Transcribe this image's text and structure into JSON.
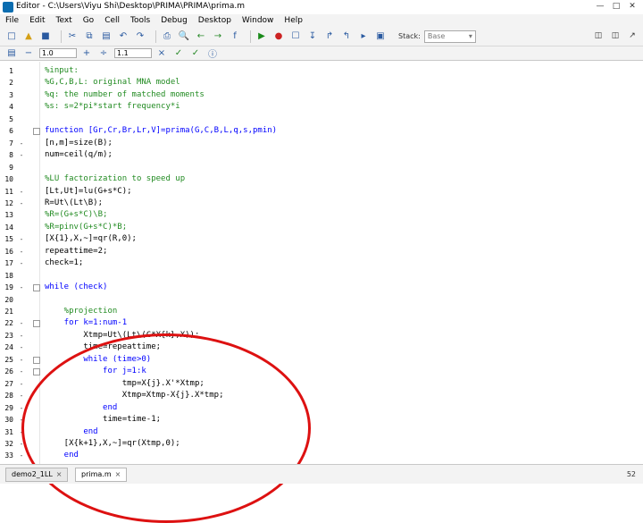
{
  "window": {
    "app": "Editor",
    "path": "C:\\Users\\Viyu Shi\\Desktop\\PRIMA\\PRIMA\\prima.m"
  },
  "menu": [
    "File",
    "Edit",
    "Text",
    "Go",
    "Cell",
    "Tools",
    "Debug",
    "Desktop",
    "Window",
    "Help"
  ],
  "toolbar": {
    "stack_label": "Stack:",
    "stack_value": "Base"
  },
  "cellbar": {
    "value1": "1.0",
    "value2": "1.1"
  },
  "lines": [
    {
      "n": "1",
      "m": "",
      "t": "%input:",
      "c": "comment"
    },
    {
      "n": "2",
      "m": "",
      "t": "%G,C,B,L: original MNA model",
      "c": "comment"
    },
    {
      "n": "3",
      "m": "",
      "t": "%q: the number of matched moments",
      "c": "comment"
    },
    {
      "n": "4",
      "m": "",
      "t": "%s: s=2*pi*start frequency*i",
      "c": "comment"
    },
    {
      "n": "5",
      "m": "",
      "t": "",
      "c": "normal"
    },
    {
      "n": "6",
      "m": "",
      "t": "function [Gr,Cr,Br,Lr,V]=prima(G,C,B,L,q,s,pmin)",
      "c": "kw"
    },
    {
      "n": "7",
      "m": "-",
      "t": "[n,m]=size(B);",
      "c": "normal"
    },
    {
      "n": "8",
      "m": "-",
      "t": "num=ceil(q/m);",
      "c": "normal"
    },
    {
      "n": "9",
      "m": "",
      "t": "",
      "c": "normal"
    },
    {
      "n": "10",
      "m": "",
      "t": "%LU factorization to speed up",
      "c": "comment"
    },
    {
      "n": "11",
      "m": "-",
      "t": "[Lt,Ut]=lu(G+s*C);",
      "c": "normal"
    },
    {
      "n": "12",
      "m": "-",
      "t": "R=Ut\\(Lt\\B);",
      "c": "normal"
    },
    {
      "n": "13",
      "m": "",
      "t": "%R=(G+s*C)\\B;",
      "c": "comment"
    },
    {
      "n": "14",
      "m": "",
      "t": "%R=pinv(G+s*C)*B;",
      "c": "comment"
    },
    {
      "n": "15",
      "m": "-",
      "t": "[X{1},X,~]=qr(R,0);",
      "c": "normal"
    },
    {
      "n": "16",
      "m": "-",
      "t": "repeattime=2;",
      "c": "normal"
    },
    {
      "n": "17",
      "m": "-",
      "t": "check=1;",
      "c": "normal"
    },
    {
      "n": "18",
      "m": "",
      "t": "",
      "c": "normal"
    },
    {
      "n": "19",
      "m": "-",
      "t": "while (check)",
      "c": "kw"
    },
    {
      "n": "20",
      "m": "",
      "t": "",
      "c": "normal"
    },
    {
      "n": "21",
      "m": "",
      "t": "    %projection",
      "c": "comment"
    },
    {
      "n": "22",
      "m": "-",
      "t": "    for k=1:num-1",
      "c": "kw"
    },
    {
      "n": "23",
      "m": "-",
      "t": "        Xtmp=Ut\\(Lt\\(C*X{k},X));",
      "c": "normal"
    },
    {
      "n": "24",
      "m": "-",
      "t": "        time=repeattime;",
      "c": "normal"
    },
    {
      "n": "25",
      "m": "-",
      "t": "        while (time>0)",
      "c": "kw"
    },
    {
      "n": "26",
      "m": "-",
      "t": "            for j=1:k",
      "c": "kw"
    },
    {
      "n": "27",
      "m": "-",
      "t": "                tmp=X{j}.X'*Xtmp;",
      "c": "normal"
    },
    {
      "n": "28",
      "m": "-",
      "t": "                Xtmp=Xtmp-X{j}.X*tmp;",
      "c": "normal"
    },
    {
      "n": "29",
      "m": "-",
      "t": "            end",
      "c": "kw"
    },
    {
      "n": "30",
      "m": "-",
      "t": "            time=time-1;",
      "c": "normal"
    },
    {
      "n": "31",
      "m": "-",
      "t": "        end",
      "c": "kw"
    },
    {
      "n": "32",
      "m": "-",
      "t": "    [X{k+1},X,~]=qr(Xtmp,0);",
      "c": "normal"
    },
    {
      "n": "33",
      "m": "-",
      "t": "    end",
      "c": "kw"
    }
  ],
  "tabs": [
    "demo2_1LL",
    "prima.m"
  ],
  "page_number": "52"
}
